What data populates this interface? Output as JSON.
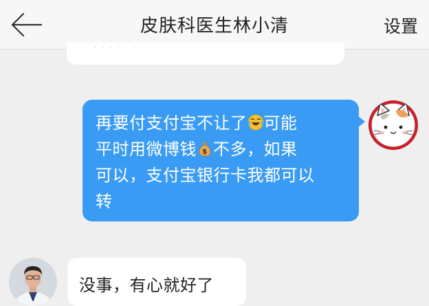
{
  "header": {
    "back_icon": "arrow-left-icon",
    "title": "皮肤科医生林小清",
    "settings_label": "设置"
  },
  "messages": [
    {
      "side": "right",
      "lines": [
        {
          "before": "再要付支付宝不让了",
          "emoji": "crying-laughing-emoji",
          "after": "可能"
        },
        {
          "before": "平时用微博钱",
          "emoji": "money-bag-emoji",
          "after": "不多，如果"
        },
        {
          "before": "可以，支付宝银行卡我都可以",
          "emoji": "",
          "after": ""
        },
        {
          "before": "转",
          "emoji": "",
          "after": ""
        }
      ]
    },
    {
      "side": "left",
      "text": "没事，有心就好了"
    }
  ],
  "colors": {
    "outgoing_bubble": "#3a9bf4",
    "incoming_bubble": "#ffffff",
    "background": "#efefef",
    "header": "#f7f7f7"
  }
}
